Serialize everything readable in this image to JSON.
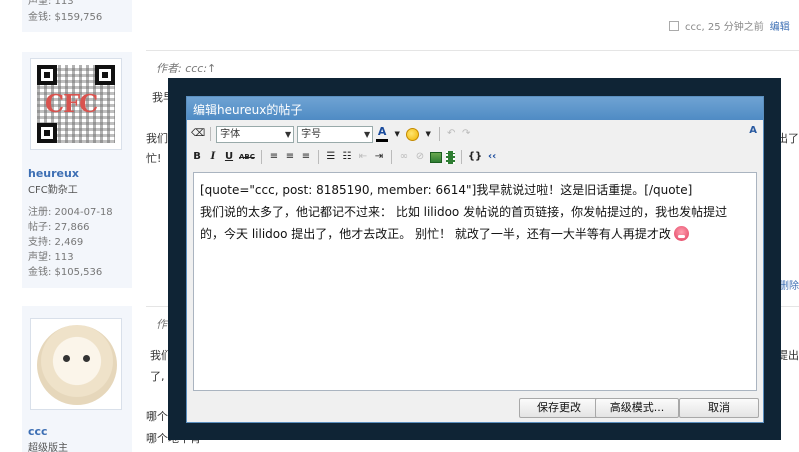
{
  "users": [
    {
      "rep": "声望: 113",
      "money": "金钱: $159,756"
    },
    {
      "name": "heureux",
      "title": "CFC勤杂工",
      "logo": "CFC",
      "registered": "注册: 2004-07-18",
      "posts": "帖子: 27,866",
      "support": "支持: 2,469",
      "rep": "声望: 113",
      "money": "金钱: $105,536"
    },
    {
      "name": "ccc",
      "title": "超级版主"
    }
  ],
  "posts": {
    "meta_text": "ccc, 25 分钟之前",
    "meta_edit": "编辑",
    "author_label": "作者: ccc:↑",
    "p2_line1": "我早",
    "p2_line2a": "我们",
    "p2_line2b": "忙!",
    "p2_right1": "出了",
    "p2_right2": "删除",
    "p3_author": "作",
    "p3_line1": "我们",
    "p3_line2": "了,",
    "p3_right": "提出",
    "p4_line1": "哪个",
    "p4_line2": "哪个地不肯"
  },
  "dialog": {
    "title": "编辑heureux的帖子",
    "toolbar": {
      "font_placeholder": "字体",
      "size_placeholder": "字号",
      "bold": "B",
      "italic": "I",
      "underline": "U",
      "strike": "ABC",
      "color": "A",
      "code": "{}",
      "quote": "‹‹",
      "right_icon": "A"
    },
    "content": {
      "quote_line": "[quote=\"ccc, post: 8185190, member: 6614\"]我早就说过啦！这是旧话重提。[/quote]",
      "body": "我们说的太多了，他记都记不过来： 比如 lilidoo 发帖说的首页链接，你发帖提过的，我也发帖提过的，今天 lilidoo 提出了，他才去改正。 别忙！ 就改了一半，还有一大半等有人再提才改"
    },
    "buttons": {
      "save": "保存更改",
      "advanced": "高级模式...",
      "cancel": "取消"
    }
  }
}
